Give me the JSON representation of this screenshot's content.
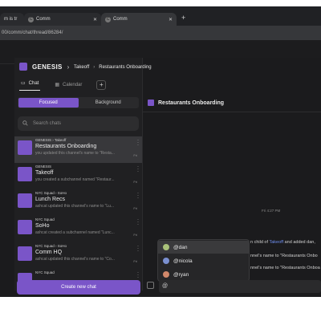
{
  "browser": {
    "tabs": [
      {
        "label": "m is tr",
        "favicon": ""
      },
      {
        "label": "Comm",
        "favicon": "C"
      },
      {
        "label": "Comm",
        "favicon": "C"
      }
    ],
    "url": "00/comm/chat/thread/86284/"
  },
  "workspace": {
    "name": "GENESIS"
  },
  "breadcrumb": {
    "a": "Takeoff",
    "b": "Restaurants Onboarding"
  },
  "nav": {
    "chat": "Chat",
    "calendar": "Calendar"
  },
  "segments": {
    "focused": "Focused",
    "background": "Background"
  },
  "search": {
    "placeholder": "Search chats"
  },
  "chats": [
    {
      "sup": "GENESIS › Takeoff",
      "name": "Restaurants Onboarding",
      "preview": "you updated this channel's name to \"Resta...",
      "time": "Fri"
    },
    {
      "sup": "GENESIS",
      "name": "Takeoff",
      "preview": "you created a subchannel named \"Restaur...",
      "time": "Fri"
    },
    {
      "sup": "NYC Squad › SoHo",
      "name": "Lunch Recs",
      "preview": "ashcat updated this channel's name to \"Lu...",
      "time": "Fri"
    },
    {
      "sup": "NYC Squad",
      "name": "SoHo",
      "preview": "ashcat created a subchannel named \"Lunc...",
      "time": "Fri"
    },
    {
      "sup": "NYC Squad › SoHo",
      "name": "Comm HQ",
      "preview": "ashcat updated this channel's name to \"Co...",
      "time": "Fri"
    },
    {
      "sup": "NYC Squad",
      "name": "",
      "preview": "",
      "time": ""
    }
  ],
  "new_chat": "Create new chat",
  "channel": {
    "title": "Restaurants Onboarding"
  },
  "timeline": {
    "date": "Fri 4:27 PM",
    "m1_pre": "n child of ",
    "m1_link": "Takeoff",
    "m1_post": " and added dan,",
    "m2": "nnel's name to \"Restaurants Onbo",
    "m3": "nnel's name to \"Restaurants Onboa"
  },
  "mentions": [
    {
      "label": "@dan",
      "color": "#a9c27a"
    },
    {
      "label": "@nicola",
      "color": "#7a8fd0"
    },
    {
      "label": "@ryan",
      "color": "#d0876a"
    }
  ],
  "composer": {
    "value": "@"
  }
}
